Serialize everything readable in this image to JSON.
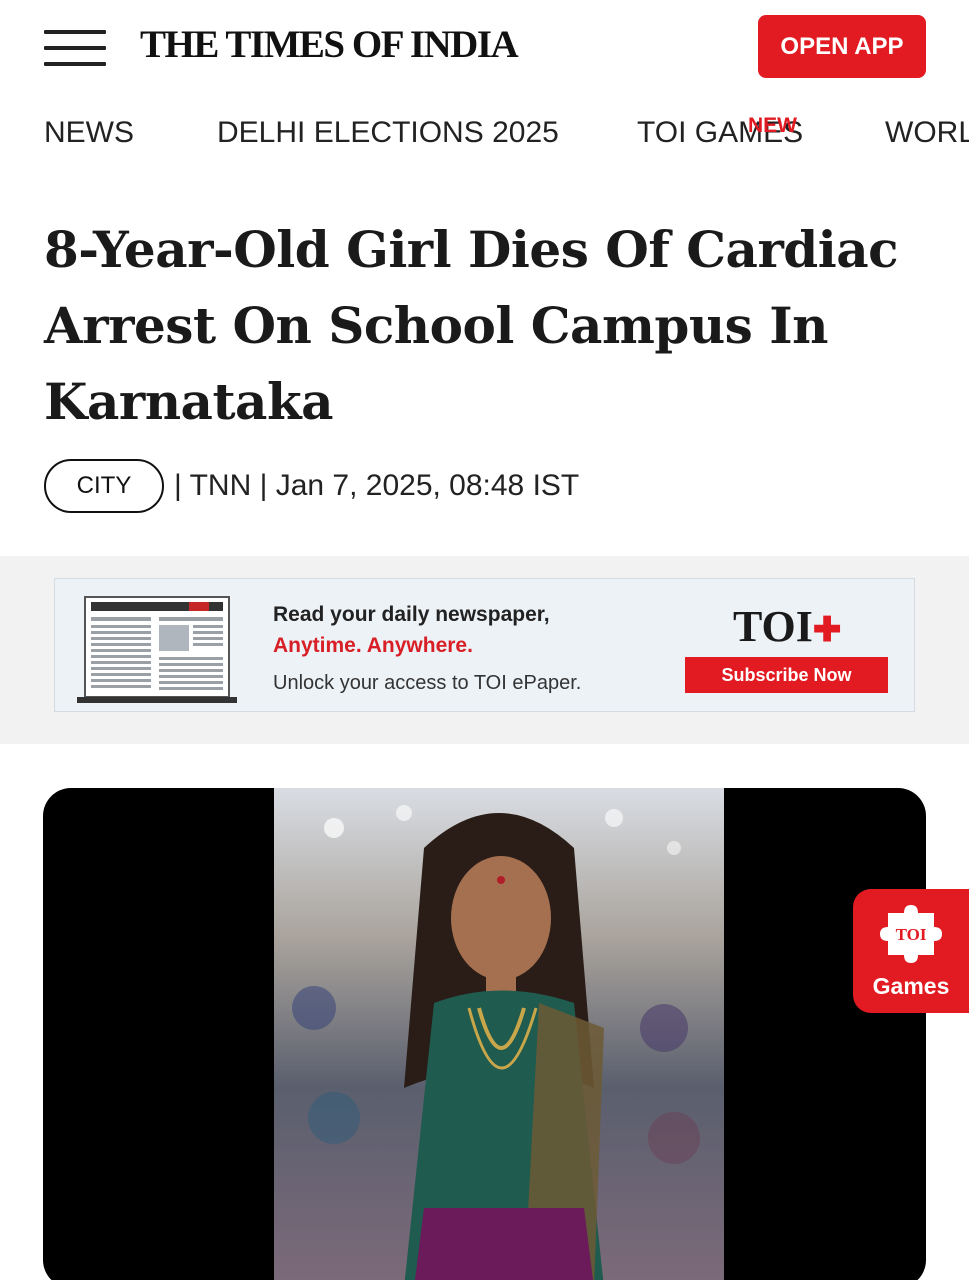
{
  "header": {
    "logo": "THE TIMES OF INDIA",
    "open_app_label": "OPEN APP"
  },
  "nav": {
    "items": [
      {
        "label": "NEWS"
      },
      {
        "label": "DELHI ELECTIONS 2025"
      },
      {
        "label": "TOI GAMES",
        "badge": "NEW"
      },
      {
        "label": "WORLD"
      }
    ]
  },
  "article": {
    "headline": "8-Year-Old Girl Dies Of Cardiac Arrest On School Campus In Karnataka",
    "category": "CITY",
    "byline": "| TNN | Jan 7, 2025, 08:48 IST"
  },
  "banner": {
    "line1": "Read your daily newspaper,",
    "line2": "Anytime. Anywhere.",
    "line3": "Unlock your access to TOI ePaper.",
    "brand": "TOI",
    "brand_plus": "✚",
    "subscribe_label": "Subscribe Now"
  },
  "games_fab": {
    "icon_text": "TOI",
    "label": "Games"
  },
  "colors": {
    "brand_red": "#e21b22",
    "text": "#1a1a1a"
  }
}
